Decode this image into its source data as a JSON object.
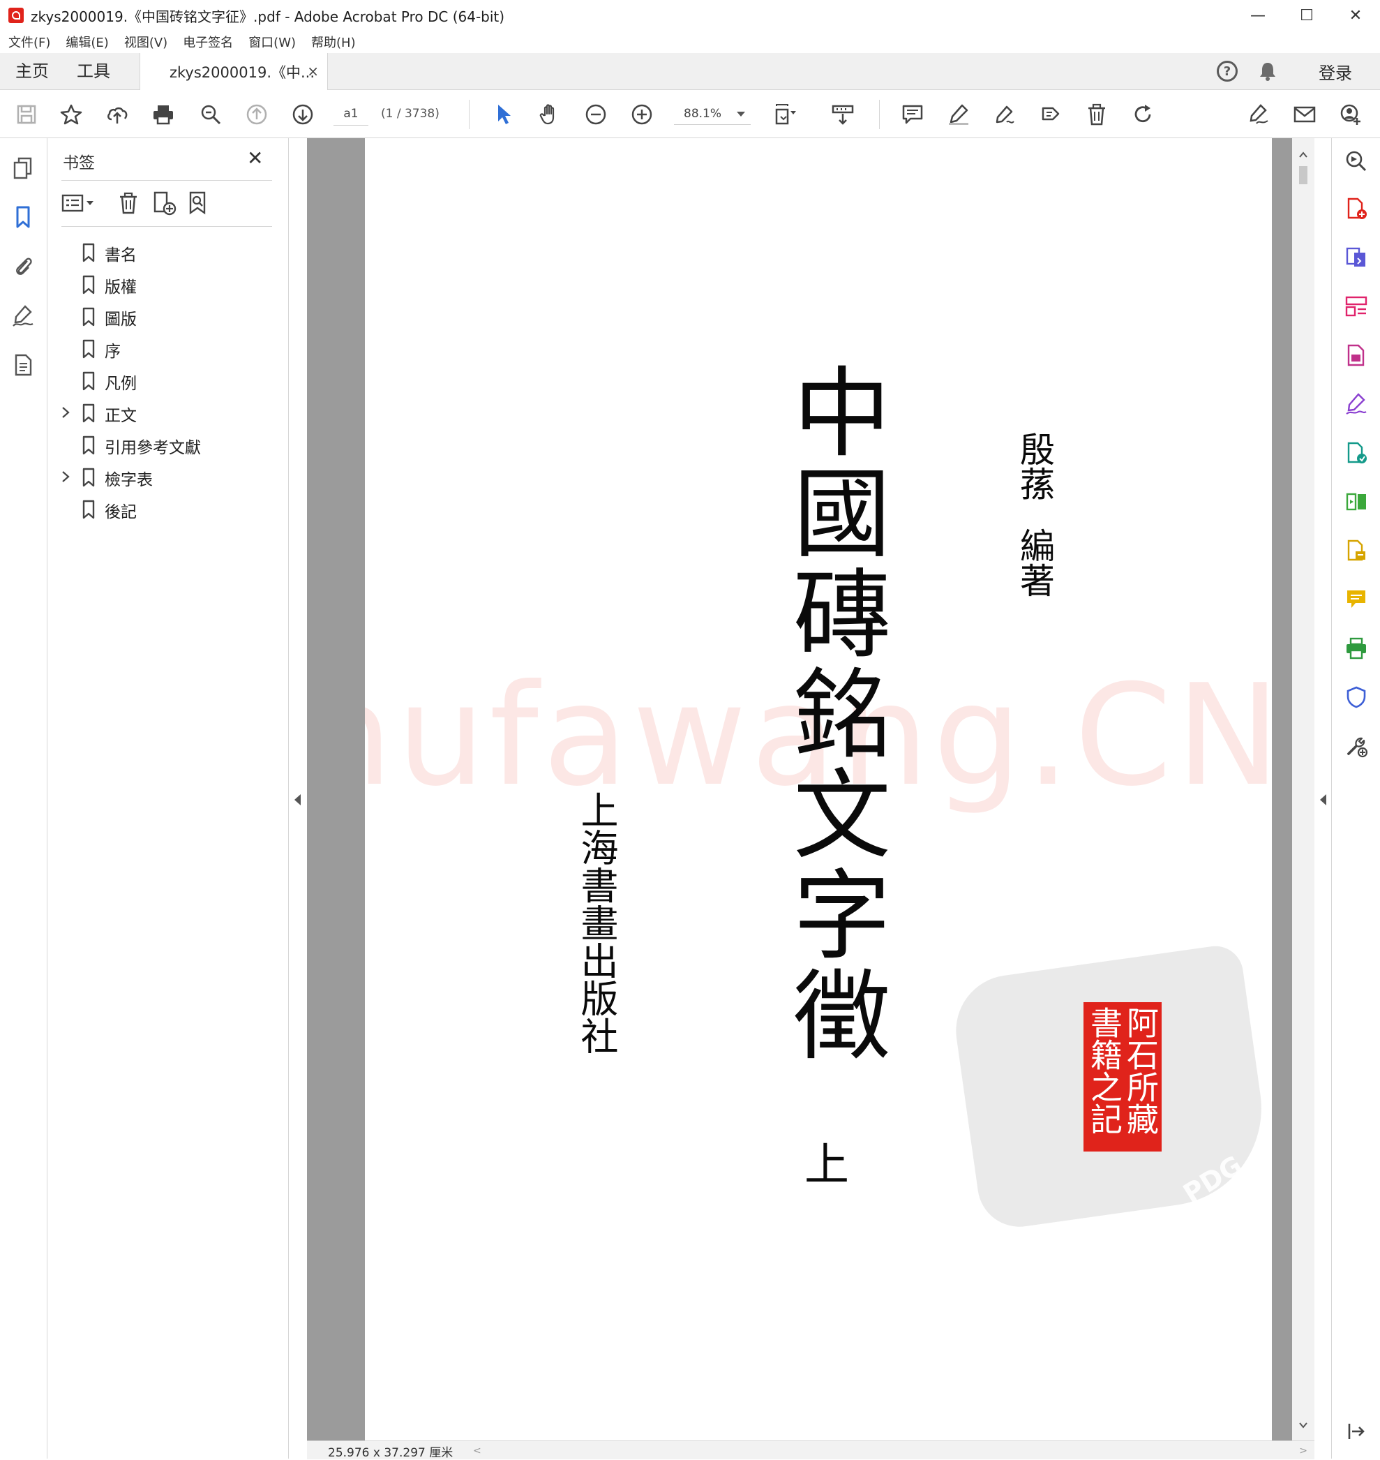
{
  "window": {
    "title": "zkys2000019.《中国砖铭文字征》.pdf - Adobe Acrobat Pro DC (64-bit)",
    "controls": [
      "—",
      "☐",
      "✕"
    ]
  },
  "menu": [
    "文件(F)",
    "编辑(E)",
    "视图(V)",
    "电子签名",
    "窗口(W)",
    "帮助(H)"
  ],
  "tabs": {
    "home": "主页",
    "tools": "工具",
    "doc": "zkys2000019.《中...",
    "close": "×",
    "help": "?",
    "login": "登录"
  },
  "toolbar": {
    "page_input": "a1",
    "page_count": "(1 / 3738)",
    "zoom": "88.1%"
  },
  "bookmarks": {
    "title": "书签",
    "close": "✕",
    "items": [
      {
        "label": "書名",
        "expandable": false
      },
      {
        "label": "版權",
        "expandable": false
      },
      {
        "label": "圖版",
        "expandable": false
      },
      {
        "label": "序",
        "expandable": false
      },
      {
        "label": "凡例",
        "expandable": false
      },
      {
        "label": "正文",
        "expandable": true
      },
      {
        "label": "引用參考文獻",
        "expandable": false
      },
      {
        "label": "檢字表",
        "expandable": true
      },
      {
        "label": "後記",
        "expandable": false
      }
    ]
  },
  "page": {
    "title": "中國磚銘文字徵",
    "author_name": "殷蓀",
    "author_role": "編著",
    "publisher": "上海書畫出版社",
    "volume": "上",
    "watermark": "Shufawang.CN",
    "seal_text": "阿石所藏書籍之記",
    "seal_faint": "PDG"
  },
  "status": {
    "dimensions": "25.976 x 37.297 厘米"
  },
  "colors": {
    "accent_blue": "#2f6fd6",
    "acrobat_red": "#e0231b",
    "seal_red": "#e0231b"
  }
}
